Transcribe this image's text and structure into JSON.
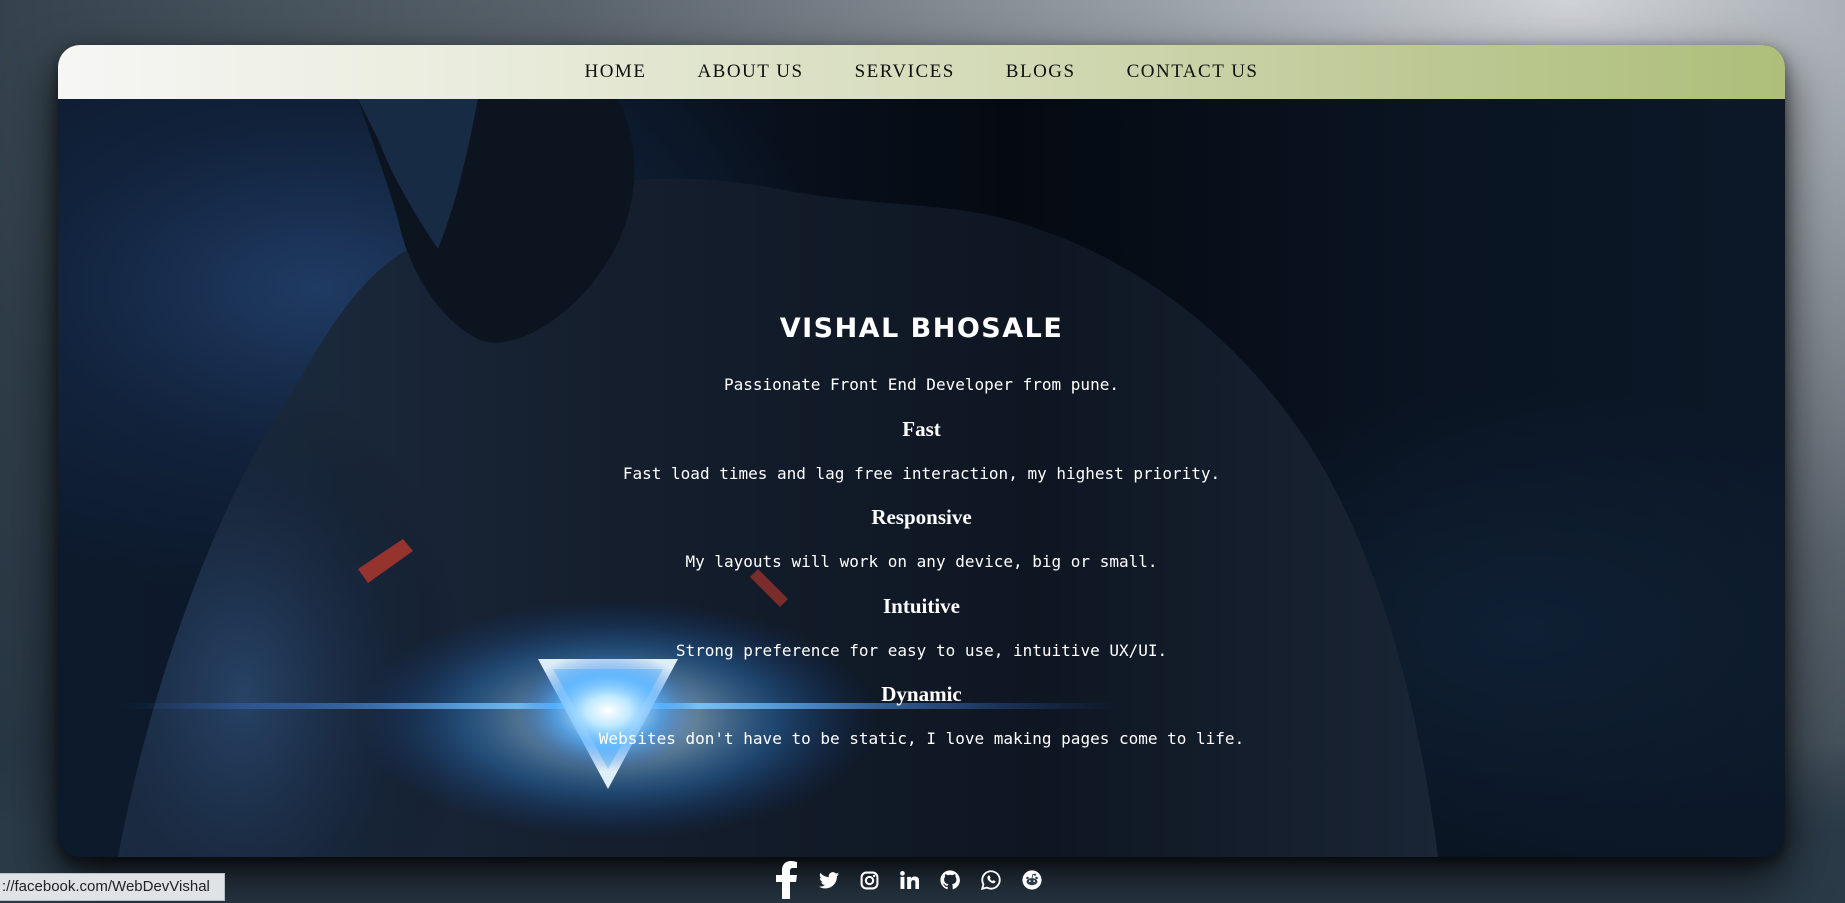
{
  "nav": {
    "items": [
      {
        "label": "HOME"
      },
      {
        "label": "ABOUT US"
      },
      {
        "label": "SERVICES"
      },
      {
        "label": "BLOGS"
      },
      {
        "label": "CONTACT US"
      }
    ]
  },
  "hero": {
    "name": "VISHAL BHOSALE",
    "tagline": "Passionate Front End Developer from pune.",
    "features": [
      {
        "title": "Fast",
        "description": "Fast load times and lag free interaction, my highest priority."
      },
      {
        "title": "Responsive",
        "description": "My layouts will work on any device, big or small."
      },
      {
        "title": "Intuitive",
        "description": "Strong preference for easy to use, intuitive UX/UI."
      },
      {
        "title": "Dynamic",
        "description": "Websites don't have to be static, I love making pages come to life."
      }
    ]
  },
  "social": {
    "icons": [
      "facebook-icon",
      "twitter-icon",
      "instagram-icon",
      "linkedin-icon",
      "github-icon",
      "whatsapp-icon",
      "reddit-icon"
    ]
  },
  "status_bar": {
    "url": "://facebook.com/WebDevVishal"
  },
  "colors": {
    "nav_gradient_start": "#f6f6f4",
    "nav_gradient_end": "#adbf7a",
    "hero_text": "#ffffff",
    "glow": "#7fd0ff"
  }
}
